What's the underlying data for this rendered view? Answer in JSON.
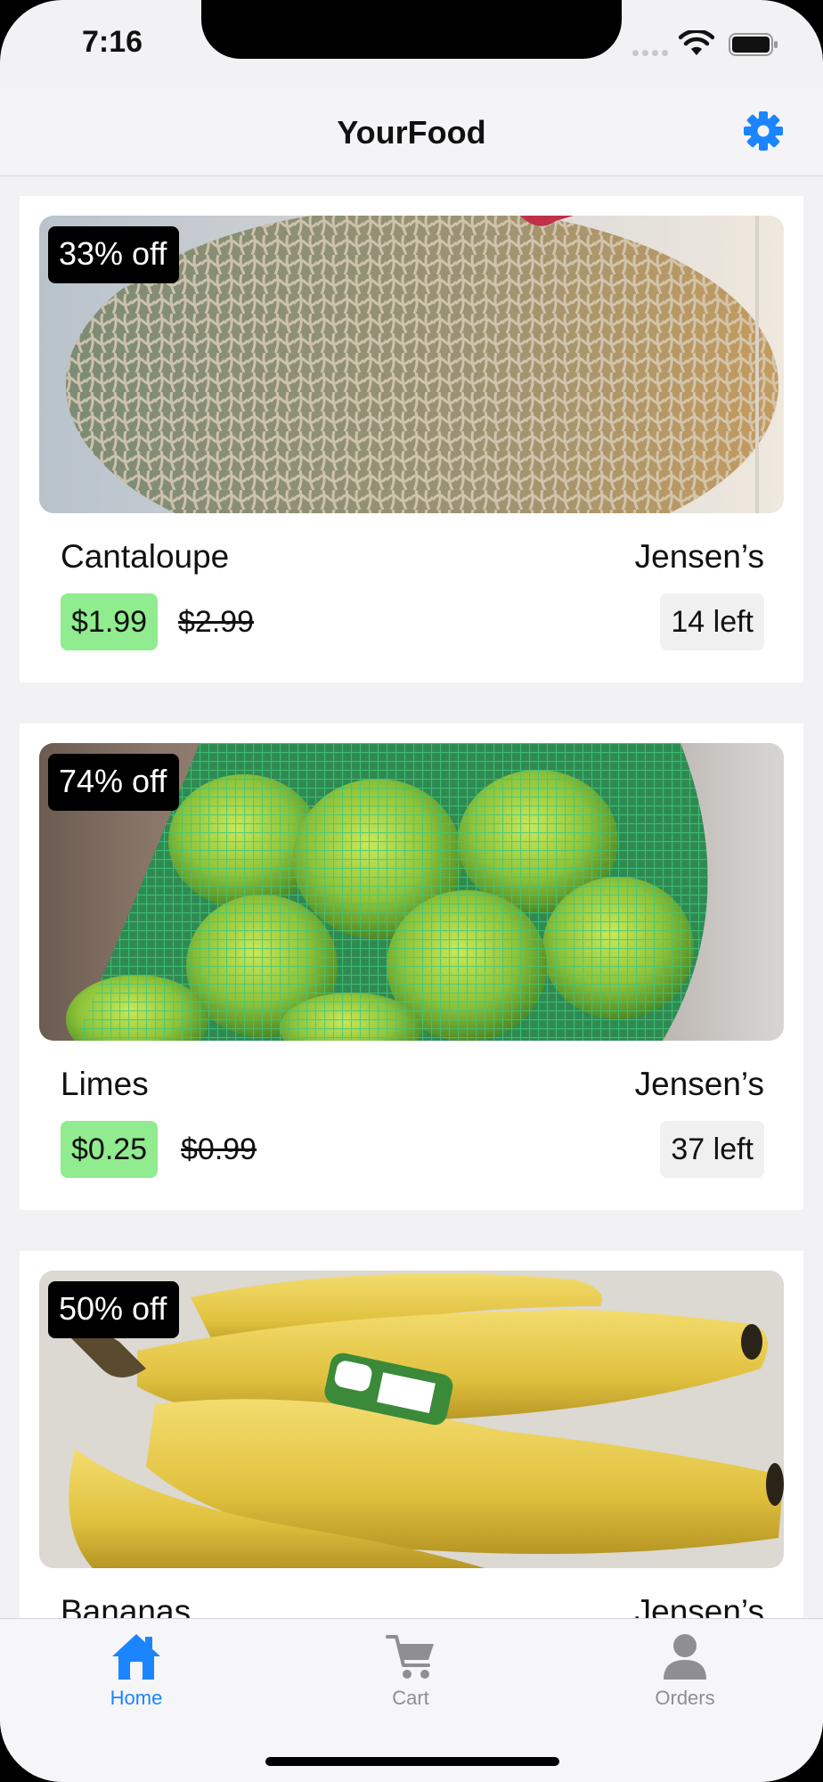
{
  "status_bar": {
    "time": "7:16"
  },
  "nav": {
    "title": "YourFood"
  },
  "products": [
    {
      "discount": "33% off",
      "name": "Cantaloupe",
      "store": "Jensen’s",
      "price": "$1.99",
      "original_price": "$2.99",
      "stock": "14 left"
    },
    {
      "discount": "74% off",
      "name": "Limes",
      "store": "Jensen’s",
      "price": "$0.25",
      "original_price": "$0.99",
      "stock": "37 left"
    },
    {
      "discount": "50% off",
      "name": "Bananas",
      "store": "Jensen’s"
    }
  ],
  "tabs": [
    {
      "label": "Home",
      "icon": "home-icon",
      "active": true
    },
    {
      "label": "Cart",
      "icon": "cart-icon",
      "active": false
    },
    {
      "label": "Orders",
      "icon": "person-icon",
      "active": false
    }
  ],
  "colors": {
    "accent": "#1a85ff",
    "sale_price_bg": "#90ec8e",
    "inactive_tab": "#8e8e93"
  }
}
